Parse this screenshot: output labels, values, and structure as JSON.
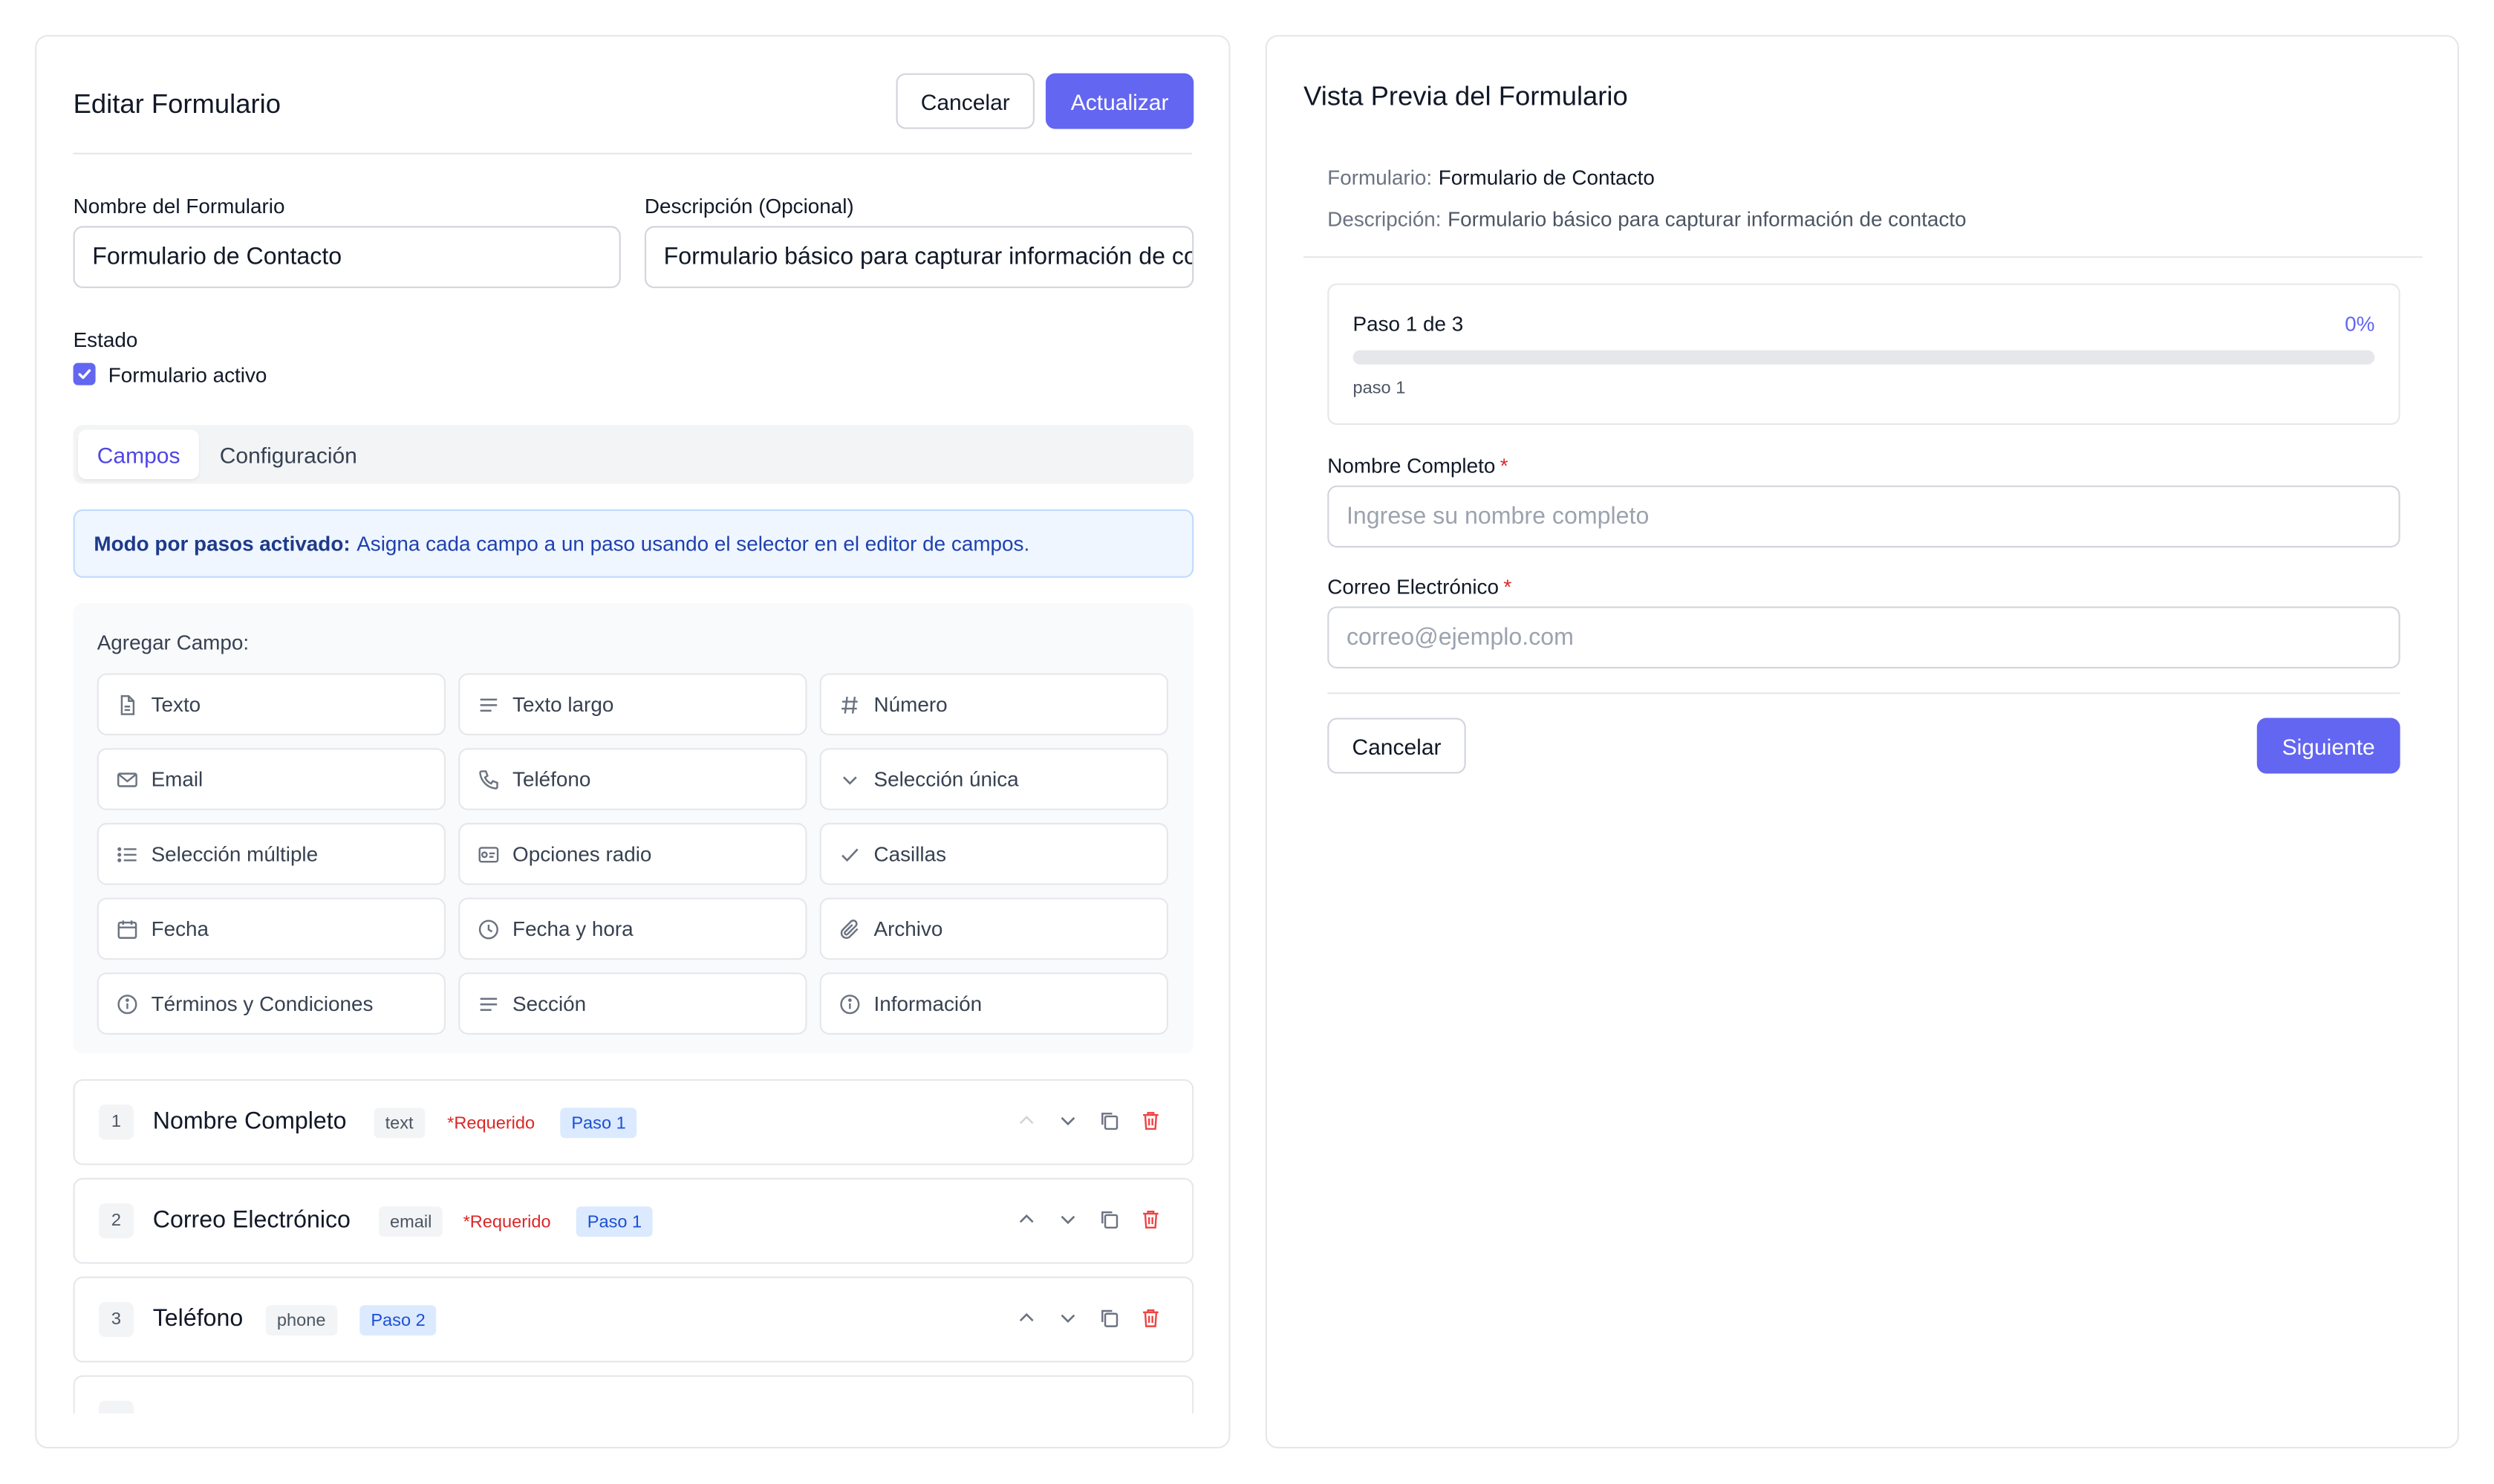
{
  "editor": {
    "title": "Editar Formulario",
    "cancel_label": "Cancelar",
    "update_label": "Actualizar",
    "name_label": "Nombre del Formulario",
    "name_value": "Formulario de Contacto",
    "desc_label": "Descripción (Opcional)",
    "desc_value": "Formulario básico para capturar información de contacto",
    "status_label": "Estado",
    "active_label": "Formulario activo",
    "active_checked": true,
    "tabs": [
      {
        "label": "Campos",
        "active": true
      },
      {
        "label": "Configuración",
        "active": false
      }
    ],
    "info_bold": "Modo por pasos activado:",
    "info_text": "Asigna cada campo a un paso usando el selector en el editor de campos.",
    "add_field_title": "Agregar Campo:",
    "field_types": [
      {
        "label": "Texto",
        "icon": "file-text-icon"
      },
      {
        "label": "Texto largo",
        "icon": "align-left-icon"
      },
      {
        "label": "Número",
        "icon": "hash-icon"
      },
      {
        "label": "Email",
        "icon": "mail-icon"
      },
      {
        "label": "Teléfono",
        "icon": "phone-icon"
      },
      {
        "label": "Selección única",
        "icon": "chevron-down-icon"
      },
      {
        "label": "Selección múltiple",
        "icon": "list-icon"
      },
      {
        "label": "Opciones radio",
        "icon": "radio-icon"
      },
      {
        "label": "Casillas",
        "icon": "check-icon"
      },
      {
        "label": "Fecha",
        "icon": "calendar-icon"
      },
      {
        "label": "Fecha y hora",
        "icon": "clock-icon"
      },
      {
        "label": "Archivo",
        "icon": "paperclip-icon"
      },
      {
        "label": "Términos y Condiciones",
        "icon": "info-icon"
      },
      {
        "label": "Sección",
        "icon": "align-left-icon"
      },
      {
        "label": "Información",
        "icon": "info-icon"
      }
    ],
    "fields": [
      {
        "num": "1",
        "name": "Nombre Completo",
        "type": "text",
        "required": "*Requerido",
        "step": "Paso 1"
      },
      {
        "num": "2",
        "name": "Correo Electrónico",
        "type": "email",
        "required": "*Requerido",
        "step": "Paso 1"
      },
      {
        "num": "3",
        "name": "Teléfono",
        "type": "phone",
        "required": "",
        "step": "Paso 2"
      }
    ]
  },
  "preview": {
    "title": "Vista Previa del Formulario",
    "form_label": "Formulario:",
    "form_value": "Formulario de Contacto",
    "desc_label": "Descripción:",
    "desc_value": "Formulario básico para capturar información de contacto",
    "step_text": "Paso 1 de 3",
    "percent_text": "0%",
    "progress": 0,
    "step_name": "paso 1",
    "field1_label": "Nombre Completo",
    "field1_star": "*",
    "field1_placeholder": "Ingrese su nombre completo",
    "field2_label": "Correo Electrónico",
    "field2_star": "*",
    "field2_placeholder": "correo@ejemplo.com",
    "cancel_label": "Cancelar",
    "next_label": "Siguiente"
  },
  "colors": {
    "accent": "#6366f1",
    "required": "#dc2626",
    "step_badge": "#dbeafe"
  }
}
